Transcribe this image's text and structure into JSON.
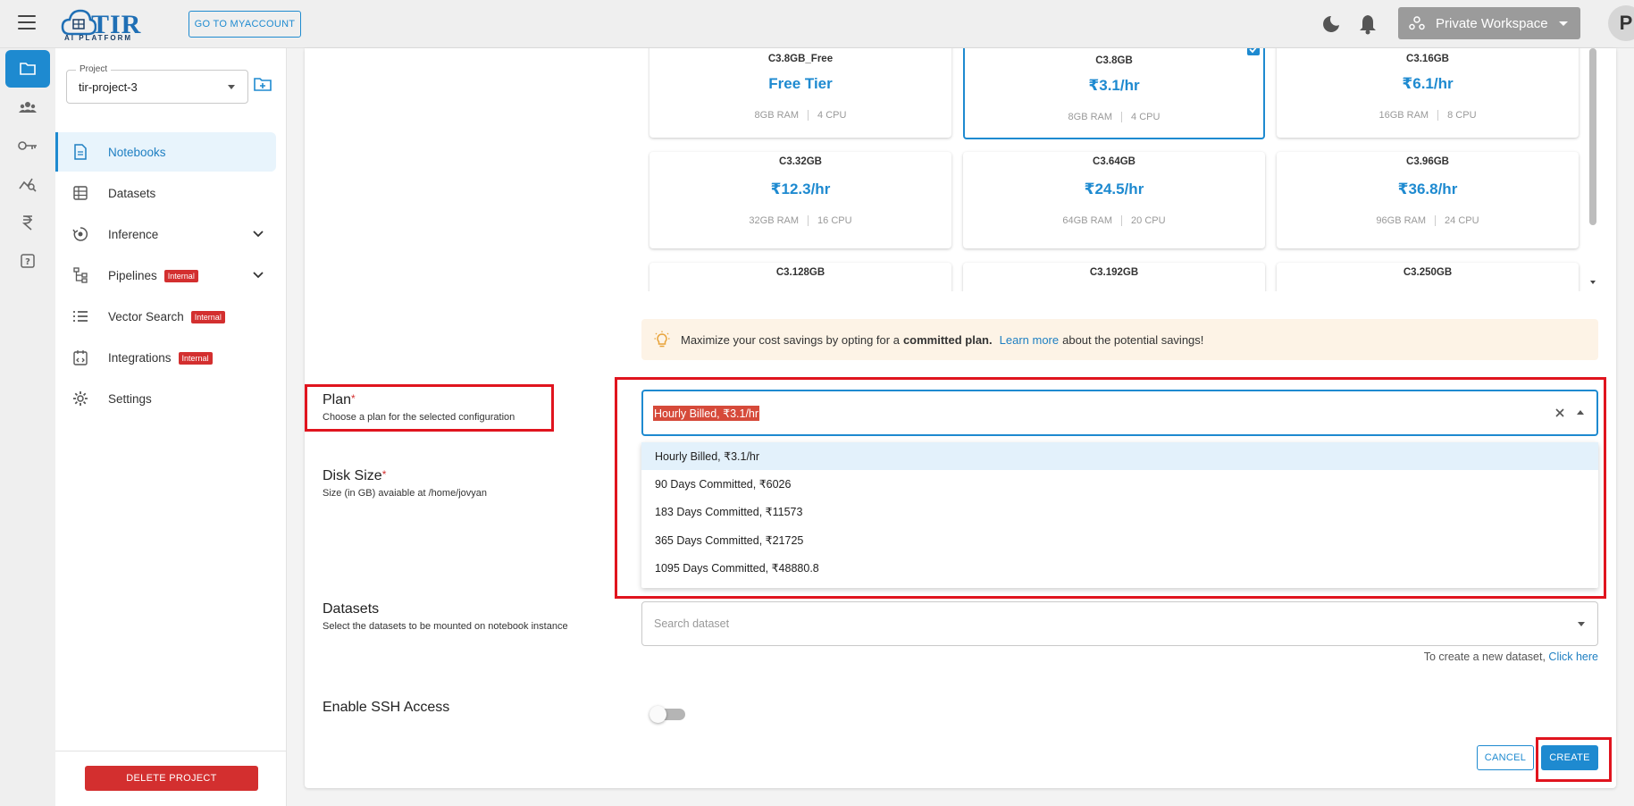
{
  "header": {
    "logo_text": "TIR",
    "logo_subtext": "AI PLATFORM",
    "myaccount_label": "GO TO MYACCOUNT",
    "workspace_label": "Private Workspace",
    "avatar_initial": "P"
  },
  "sidebar": {
    "project_legend": "Project",
    "project_value": "tir-project-3",
    "items": [
      {
        "label": "Notebooks",
        "icon": "notebook-icon"
      },
      {
        "label": "Datasets",
        "icon": "dataset-grid-icon"
      },
      {
        "label": "Inference",
        "icon": "inference-icon"
      },
      {
        "label": "Pipelines",
        "icon": "pipelines-icon",
        "badge": "Internal"
      },
      {
        "label": "Vector Search",
        "icon": "list-icon",
        "badge": "Internal"
      },
      {
        "label": "Integrations",
        "icon": "integrations-icon",
        "badge": "Internal"
      },
      {
        "label": "Settings",
        "icon": "gear-icon"
      }
    ],
    "delete_label": "DELETE PROJECT"
  },
  "instances": [
    {
      "name": "C3.8GB_Free",
      "price": "Free Tier",
      "ram": "8GB RAM",
      "cpu": "4 CPU"
    },
    {
      "name": "C3.8GB",
      "price": "₹3.1/hr",
      "ram": "8GB RAM",
      "cpu": "4 CPU",
      "selected": true
    },
    {
      "name": "C3.16GB",
      "price": "₹6.1/hr",
      "ram": "16GB RAM",
      "cpu": "8 CPU"
    },
    {
      "name": "C3.32GB",
      "price": "₹12.3/hr",
      "ram": "32GB RAM",
      "cpu": "16 CPU"
    },
    {
      "name": "C3.64GB",
      "price": "₹24.5/hr",
      "ram": "64GB RAM",
      "cpu": "20 CPU"
    },
    {
      "name": "C3.96GB",
      "price": "₹36.8/hr",
      "ram": "96GB RAM",
      "cpu": "24 CPU"
    },
    {
      "name": "C3.128GB"
    },
    {
      "name": "C3.192GB"
    },
    {
      "name": "C3.250GB"
    }
  ],
  "banner": {
    "text_before": "Maximize your cost savings by opting for a",
    "bold": "committed plan.",
    "link": "Learn more",
    "text_after": "about the potential savings!"
  },
  "plan": {
    "label": "Plan",
    "required": "*",
    "sublabel": "Choose a plan for the selected configuration",
    "value": "Hourly Billed, ₹3.1/hr",
    "options": [
      "Hourly Billed, ₹3.1/hr",
      "90 Days Committed, ₹6026",
      "183 Days Committed, ₹11573",
      "365 Days Committed, ₹21725",
      "1095 Days Committed, ₹48880.8"
    ]
  },
  "disk": {
    "label": "Disk Size",
    "required": "*",
    "sublabel": "Size (in GB) avaiable at /home/jovyan"
  },
  "datasets": {
    "label": "Datasets",
    "sublabel": "Select the datasets to be mounted on notebook instance",
    "placeholder": "Search dataset",
    "create_text": "To create a new dataset,",
    "create_link": "Click here"
  },
  "ssh": {
    "label": "Enable SSH Access",
    "enabled": false
  },
  "actions": {
    "cancel": "CANCEL",
    "create": "CREATE"
  }
}
